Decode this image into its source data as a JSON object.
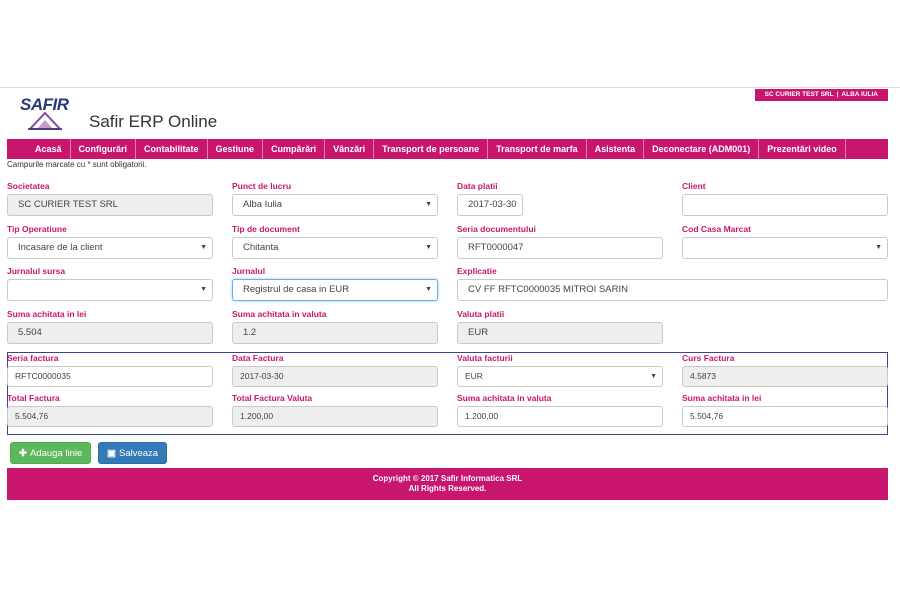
{
  "header": {
    "company": "SC CURIER TEST SRL",
    "location": "ALBA IULIA",
    "logo_text": "SAFIR",
    "app_title": "Safir ERP Online"
  },
  "nav": {
    "items": [
      "Acasă",
      "Configurări",
      "Contabilitate",
      "Gestiune",
      "Cumpărări",
      "Vânzări",
      "Transport de persoane",
      "Transport de marfa",
      "Asistenta",
      "Deconectare (ADM001)",
      "Prezentări video"
    ]
  },
  "note": "Campurile marcate cu * sunt obligatorii.",
  "form": {
    "societatea": {
      "label": "Societatea",
      "value": "SC CURIER TEST SRL"
    },
    "punct_lucru": {
      "label": "Punct de lucru",
      "value": "Alba Iulia"
    },
    "data_platii": {
      "label": "Data platii",
      "value": "2017-03-30"
    },
    "client": {
      "label": "Client",
      "value": ""
    },
    "tip_operatiune": {
      "label": "Tip Operatiune",
      "value": "Incasare de la client"
    },
    "tip_document": {
      "label": "Tip de document",
      "value": "Chitanta"
    },
    "seria_documentului": {
      "label": "Seria documentului",
      "value": "RFT0000047"
    },
    "cod_casa_marcat": {
      "label": "Cod Casa Marcat",
      "value": ""
    },
    "jurnalul_sursa": {
      "label": "Jurnalul sursa",
      "value": ""
    },
    "jurnalul": {
      "label": "Jurnalul",
      "value": "Registrul de casa in EUR"
    },
    "explicatie": {
      "label": "Explicatie",
      "value": "CV FF RFTC0000035 MITROI SARIN"
    },
    "suma_lei": {
      "label": "Suma achitata in lei",
      "value": "5.504"
    },
    "suma_valuta": {
      "label": "Suma achitata in valuta",
      "value": "1.2"
    },
    "valuta_platii": {
      "label": "Valuta platii",
      "value": "EUR"
    }
  },
  "invoice": {
    "seria_factura": {
      "label": "Seria factura",
      "value": "RFTC0000035"
    },
    "data_factura": {
      "label": "Data Factura",
      "value": "2017-03-30"
    },
    "valuta_facturii": {
      "label": "Valuta facturii",
      "value": "EUR"
    },
    "curs_factura": {
      "label": "Curs Factura",
      "value": "4.5873"
    },
    "total_factura": {
      "label": "Total Factura",
      "value": "5.504,76"
    },
    "total_factura_valuta": {
      "label": "Total Factura Valuta",
      "value": "1.200,00"
    },
    "suma_achitata_valuta": {
      "label": "Suma achitata in valuta",
      "value": "1.200,00"
    },
    "suma_achitata_lei": {
      "label": "Suma achitata in lei",
      "value": "5.504,76"
    }
  },
  "buttons": {
    "add_line": "Adauga linie",
    "save": "Salveaza"
  },
  "footer": {
    "line1": "Copyright © 2017 Safir Informatica SRL",
    "line2": "All Rights Reserved."
  },
  "colors": {
    "brand": "#c8166e",
    "add_button": "#5cb85c",
    "save_button": "#337ab7",
    "box_border": "#39439a"
  }
}
